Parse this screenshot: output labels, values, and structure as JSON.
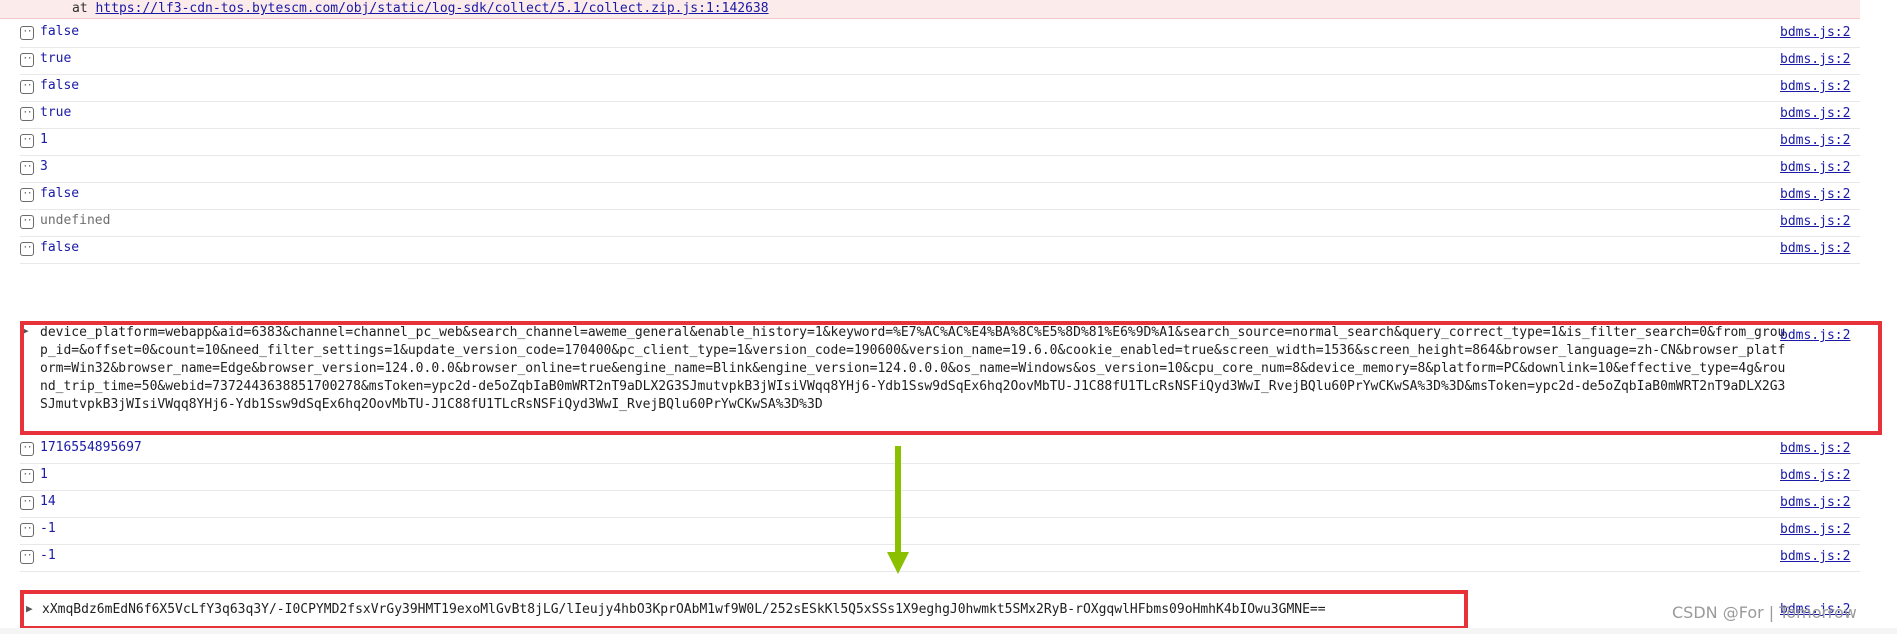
{
  "error_row": {
    "prefix": "at",
    "link": "https://lf3-cdn-tos.bytescm.com/obj/static/log-sdk/collect/5.1/collect.zip.js:1:142638"
  },
  "source_label": "bdms.js:2",
  "logs": [
    {
      "value": "false",
      "kind": "bool"
    },
    {
      "value": "true",
      "kind": "bool"
    },
    {
      "value": "false",
      "kind": "bool"
    },
    {
      "value": "true",
      "kind": "bool"
    },
    {
      "value": "1",
      "kind": "num"
    },
    {
      "value": "3",
      "kind": "num"
    },
    {
      "value": "false",
      "kind": "bool"
    },
    {
      "value": "undefined",
      "kind": "undef"
    },
    {
      "value": "false",
      "kind": "bool"
    }
  ],
  "long_string": "device_platform=webapp&aid=6383&channel=channel_pc_web&search_channel=aweme_general&enable_history=1&keyword=%E7%AC%AC%E4%BA%8C%E5%8D%81%E6%9D%A1&search_source=normal_search&query_correct_type=1&is_filter_search=0&from_group_id=&offset=0&count=10&need_filter_settings=1&update_version_code=170400&pc_client_type=1&version_code=190600&version_name=19.6.0&cookie_enabled=true&screen_width=1536&screen_height=864&browser_language=zh-CN&browser_platform=Win32&browser_name=Edge&browser_version=124.0.0.0&browser_online=true&engine_name=Blink&engine_version=124.0.0.0&os_name=Windows&os_version=10&cpu_core_num=8&device_memory=8&platform=PC&downlink=10&effective_type=4g&round_trip_time=50&webid=7372443638851700278&msToken=ypc2d-de5oZqbIaB0mWRT2nT9aDLX2G3SJmutvpkB3jWIsiVWqq8YHj6-Ydb1Ssw9dSqEx6hq2OovMbTU-J1C88fU1TLcRsNSFiQyd3WwI_RvejBQlu60PrYwCKwSA%3D%3D&msToken=ypc2d-de5oZqbIaB0mWRT2nT9aDLX2G3SJmutvpkB3jWIsiVWqq8YHj6-Ydb1Ssw9dSqEx6hq2OovMbTU-J1C88fU1TLcRsNSFiQyd3WwI_RvejBQlu60PrYwCKwSA%3D%3D",
  "logs2": [
    {
      "value": "1716554895697",
      "kind": "num"
    },
    {
      "value": "1",
      "kind": "num"
    },
    {
      "value": "14",
      "kind": "num"
    },
    {
      "value": "-1",
      "kind": "num"
    },
    {
      "value": "-1",
      "kind": "num"
    }
  ],
  "last_string": "xXmqBdz6mEdN6f6X5VcLfY3q63q3Y/-I0CPYMD2fsxVrGy39HMT19exoMlGvBt8jLG/lIeujy4hbO3KprOAbM1wf9W0L/252sESkKl5Q5xSSs1X9eghgJ0hwmkt5SMx2RyB-rOXgqwlHFbms09oHmhK4bIOwu3GMNE==",
  "watermark": "CSDN @For | Tomorrow",
  "colors": {
    "highlight": "#e8323a",
    "arrow": "#8bc000",
    "link": "#1a1aa6"
  }
}
